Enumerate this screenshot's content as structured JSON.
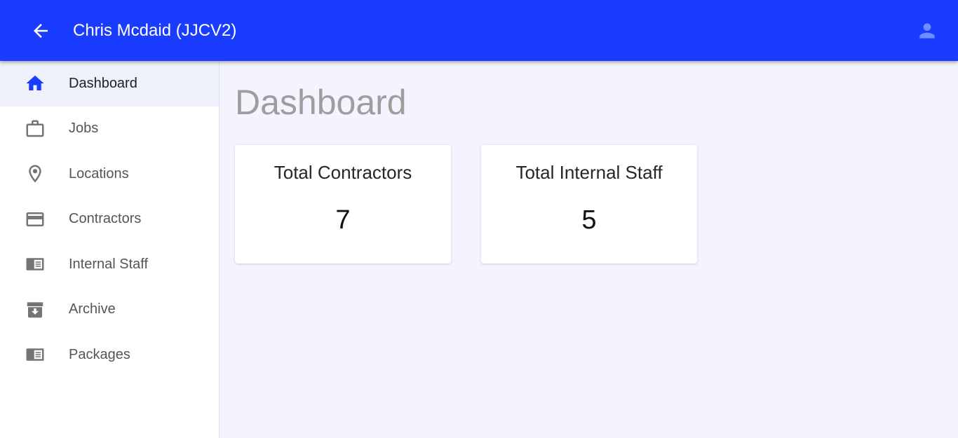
{
  "header": {
    "title": "Chris Mcdaid (JJCV2)",
    "back_icon": "arrow-left-icon",
    "user_icon": "account-icon",
    "background_color": "#1a3cff"
  },
  "sidebar": {
    "items": [
      {
        "label": "Dashboard",
        "icon": "home-icon",
        "active": true
      },
      {
        "label": "Jobs",
        "icon": "briefcase-icon",
        "active": false
      },
      {
        "label": "Locations",
        "icon": "map-pin-icon",
        "active": false
      },
      {
        "label": "Contractors",
        "icon": "credit-card-icon",
        "active": false
      },
      {
        "label": "Internal Staff",
        "icon": "id-card-icon",
        "active": false
      },
      {
        "label": "Archive",
        "icon": "archive-icon",
        "active": false
      },
      {
        "label": "Packages",
        "icon": "id-card-icon",
        "active": false
      }
    ]
  },
  "main": {
    "page_title": "Dashboard",
    "cards": [
      {
        "title": "Total Contractors",
        "value": "7"
      },
      {
        "title": "Total Internal Staff",
        "value": "5"
      }
    ]
  }
}
